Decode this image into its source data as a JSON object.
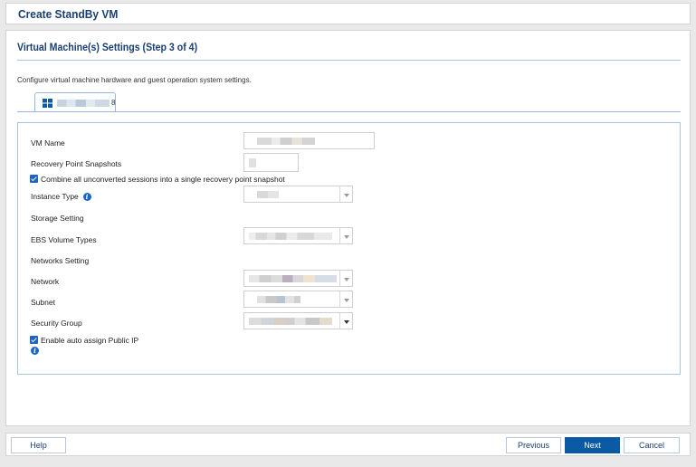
{
  "window": {
    "title": "Create StandBy VM"
  },
  "step": {
    "title": "Virtual Machine(s) Settings (Step 3 of 4)",
    "description": "Configure virtual machine hardware and guest operation system settings."
  },
  "tab": {
    "suffix": "8",
    "icon": "windows-icon"
  },
  "form": {
    "vm_name_label": "VM Name",
    "recovery_snapshots_label": "Recovery Point Snapshots",
    "combine_checkbox_label": "Combine all unconverted sessions into a single recovery point snapshot",
    "combine_checked": true,
    "instance_type_label": "Instance Type",
    "storage_setting_label": "Storage Setting",
    "ebs_volume_label": "EBS Volume Types",
    "networks_setting_label": "Networks Setting",
    "network_label": "Network",
    "subnet_label": "Subnet",
    "security_group_label": "Security Group",
    "auto_ip_label": "Enable auto assign Public IP",
    "auto_ip_checked": true
  },
  "footer": {
    "help_label": "Help",
    "previous_label": "Previous",
    "next_label": "Next",
    "cancel_label": "Cancel"
  },
  "colors": {
    "accent": "#0b5aa5",
    "title": "#1a3f73",
    "checkbox": "#1d64c8"
  }
}
